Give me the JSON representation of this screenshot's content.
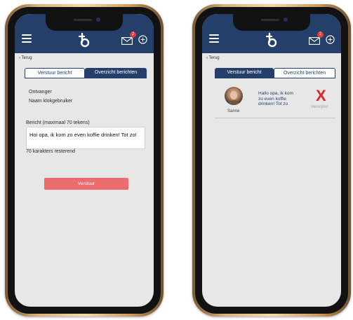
{
  "colors": {
    "header": "#24406a",
    "send_button": "#ec6c70",
    "delete": "#e02424",
    "frame_gold": "#d7b07a",
    "screen_bg": "#e7e7e7"
  },
  "icons": {
    "menu": "hamburger-menu-icon",
    "logo": "b-logo-icon",
    "mail": "mail-icon",
    "add": "plus-circle-icon"
  },
  "left_screen": {
    "header": {
      "mail_badge": "2"
    },
    "back_label": "‹ Terug",
    "tabs": [
      {
        "label": "Verstuur bericht",
        "active": true
      },
      {
        "label": "Overzicht berichten",
        "active": false
      }
    ],
    "recipient_label": "Ontvanger",
    "recipient_name_label": "Naam klokgebruiker",
    "message_label": "Bericht (maximaal 70 tekens)",
    "message_value": "Hoi opa, ik kom zo even koffie drinken! Tot zo!",
    "chars_remaining": "70 karakters resterend",
    "send_label": "Verstuur"
  },
  "right_screen": {
    "header": {
      "mail_badge": "2"
    },
    "back_label": "‹ Terug",
    "tabs": [
      {
        "label": "Verstuur bericht",
        "active": false
      },
      {
        "label": "Overzicht berichten",
        "active": true
      }
    ],
    "messages": [
      {
        "sender": "Sanne",
        "text": "Hallo opa, ik kom zo even koffie drinken! Tot zo",
        "delete_symbol": "X",
        "delete_label": "Verwijder"
      }
    ]
  }
}
